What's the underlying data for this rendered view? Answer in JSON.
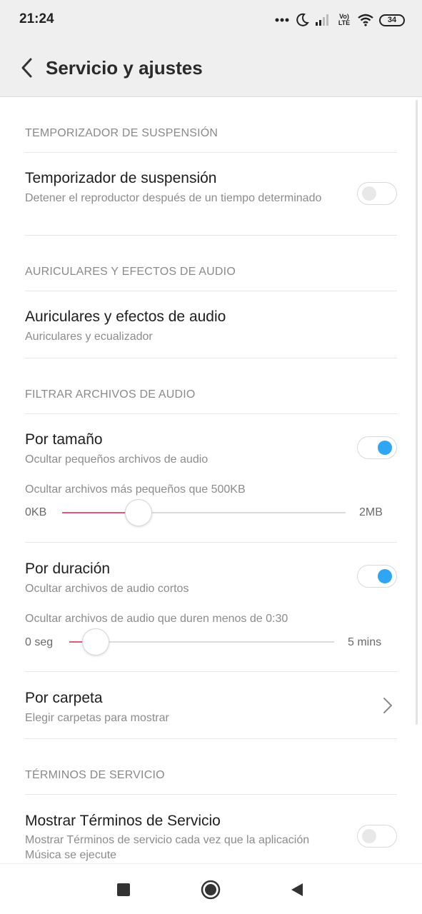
{
  "status_bar": {
    "time": "21:24",
    "network_label": "Vo) LTE",
    "battery": "34",
    "icons": [
      "more-dots-icon",
      "moon-icon",
      "signal-icon",
      "volte-icon",
      "wifi-icon",
      "battery-icon"
    ]
  },
  "app_bar": {
    "title": "Servicio y ajustes",
    "back_icon": "chevron-left-icon"
  },
  "sections": {
    "sleep_timer": {
      "header": "TEMPORIZADOR DE SUSPENSIÓN",
      "title": "Temporizador de suspensión",
      "subtitle": "Detener el reproductor después de un tiempo determinado",
      "enabled": false
    },
    "headphones": {
      "header": "AURICULARES Y EFECTOS DE AUDIO",
      "title": "Auriculares y efectos de audio",
      "subtitle": "Auriculares y ecualizador"
    },
    "filter": {
      "header": "FILTRAR ARCHIVOS DE AUDIO",
      "by_size": {
        "title": "Por tamaño",
        "subtitle": "Ocultar pequeños archivos de audio",
        "enabled": true,
        "slider_label": "Ocultar archivos más pequeños que 500KB",
        "min": "0KB",
        "max": "2MB",
        "value_fraction": 0.27
      },
      "by_duration": {
        "title": "Por duración",
        "subtitle": "Ocultar archivos de audio cortos",
        "enabled": true,
        "slider_label": "Ocultar archivos de audio que duren menos de 0:30",
        "min": "0 seg",
        "max": "5 mins",
        "value_fraction": 0.1
      },
      "by_folder": {
        "title": "Por carpeta",
        "subtitle": "Elegir carpetas para mostrar"
      }
    },
    "terms": {
      "header": "TÉRMINOS DE SERVICIO",
      "title": "Mostrar Términos de Servicio",
      "subtitle": "Mostrar Términos de servicio cada vez que la aplicación Música se ejecute",
      "enabled": false
    }
  },
  "colors": {
    "accent": "#2fa6f3",
    "slider_fill": "#e8557a",
    "header_text": "#8a8a8a",
    "bar_background": "#efefef"
  },
  "nav_bar": {
    "icons": [
      "recents-square-icon",
      "home-circle-icon",
      "back-triangle-icon"
    ]
  }
}
